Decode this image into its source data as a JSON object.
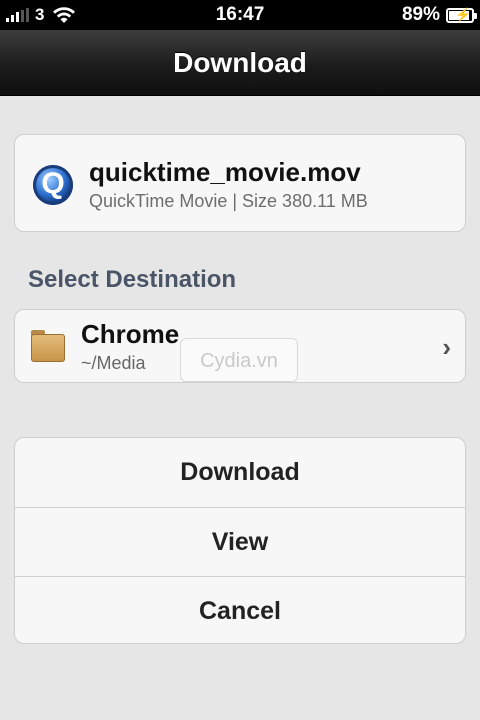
{
  "status_bar": {
    "carrier": "3",
    "time": "16:47",
    "battery": "89%"
  },
  "nav": {
    "title": "Download"
  },
  "file": {
    "name": "quicktime_movie.mov",
    "meta": "QuickTime Movie  |  Size 380.11 MB",
    "icon": "quicktime-icon"
  },
  "destination": {
    "section_label": "Select Destination",
    "name": "Chrome",
    "path": "~/Media",
    "icon": "folder-icon"
  },
  "watermark": "Cydia.vn",
  "actions": {
    "download": "Download",
    "view": "View",
    "cancel": "Cancel"
  },
  "colors": {
    "background": "#e6e6e6",
    "navbar": "#1c1c1c",
    "section_label": "#4a5568"
  }
}
